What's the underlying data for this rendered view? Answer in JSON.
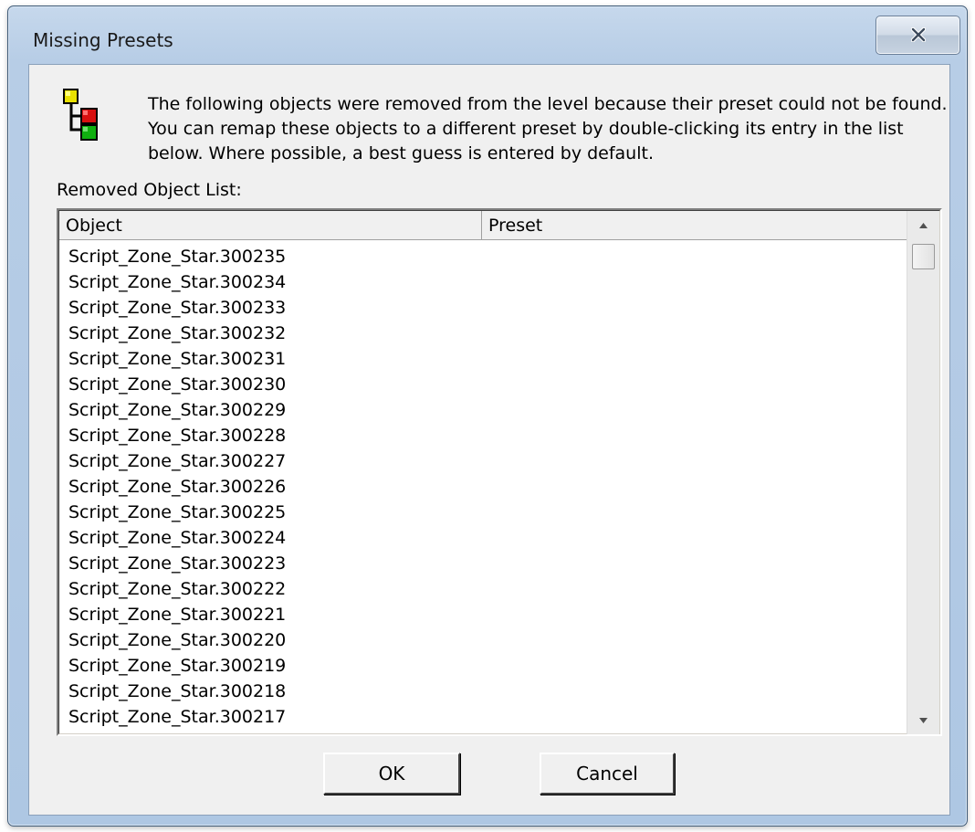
{
  "window": {
    "title": "Missing Presets"
  },
  "message": {
    "lines": [
      "The following objects were removed from the level because their preset could not be found.",
      "You can remap these objects to a different preset by double-clicking its entry in the list",
      "below.  Where possible, a best guess is entered by default."
    ]
  },
  "list": {
    "label": "Removed Object List:",
    "columns": [
      "Object",
      "Preset"
    ],
    "rows": [
      "Script_Zone_Star.300235",
      "Script_Zone_Star.300234",
      "Script_Zone_Star.300233",
      "Script_Zone_Star.300232",
      "Script_Zone_Star.300231",
      "Script_Zone_Star.300230",
      "Script_Zone_Star.300229",
      "Script_Zone_Star.300228",
      "Script_Zone_Star.300227",
      "Script_Zone_Star.300226",
      "Script_Zone_Star.300225",
      "Script_Zone_Star.300224",
      "Script_Zone_Star.300223",
      "Script_Zone_Star.300222",
      "Script_Zone_Star.300221",
      "Script_Zone_Star.300220",
      "Script_Zone_Star.300219",
      "Script_Zone_Star.300218",
      "Script_Zone_Star.300217"
    ]
  },
  "buttons": {
    "ok": "OK",
    "cancel": "Cancel"
  },
  "icons": {
    "close": "close-icon",
    "app": "tree-hierarchy-icon",
    "scroll_up": "arrow-up-icon",
    "scroll_down": "arrow-down-icon"
  },
  "colors": {
    "frame": "#b7cde6",
    "client": "#f0f0f0",
    "icon_yellow": "#e8e000",
    "icon_red": "#d81010",
    "icon_green": "#10b010"
  }
}
